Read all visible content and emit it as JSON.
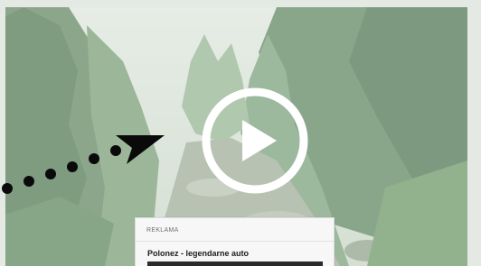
{
  "video": {
    "play_icon": "play-icon",
    "background": "forest-stream-thumbnail"
  },
  "pointer": {
    "icon": "dotted-arrow-icon"
  },
  "ad": {
    "label": "REKLAMA",
    "title": "Polonez - legendarne auto"
  },
  "colors": {
    "foliage_dark": "#2f5a33",
    "foliage_mid": "#5d8a5a",
    "overlay": "#ffffff",
    "arrow": "#0a0a0a"
  }
}
